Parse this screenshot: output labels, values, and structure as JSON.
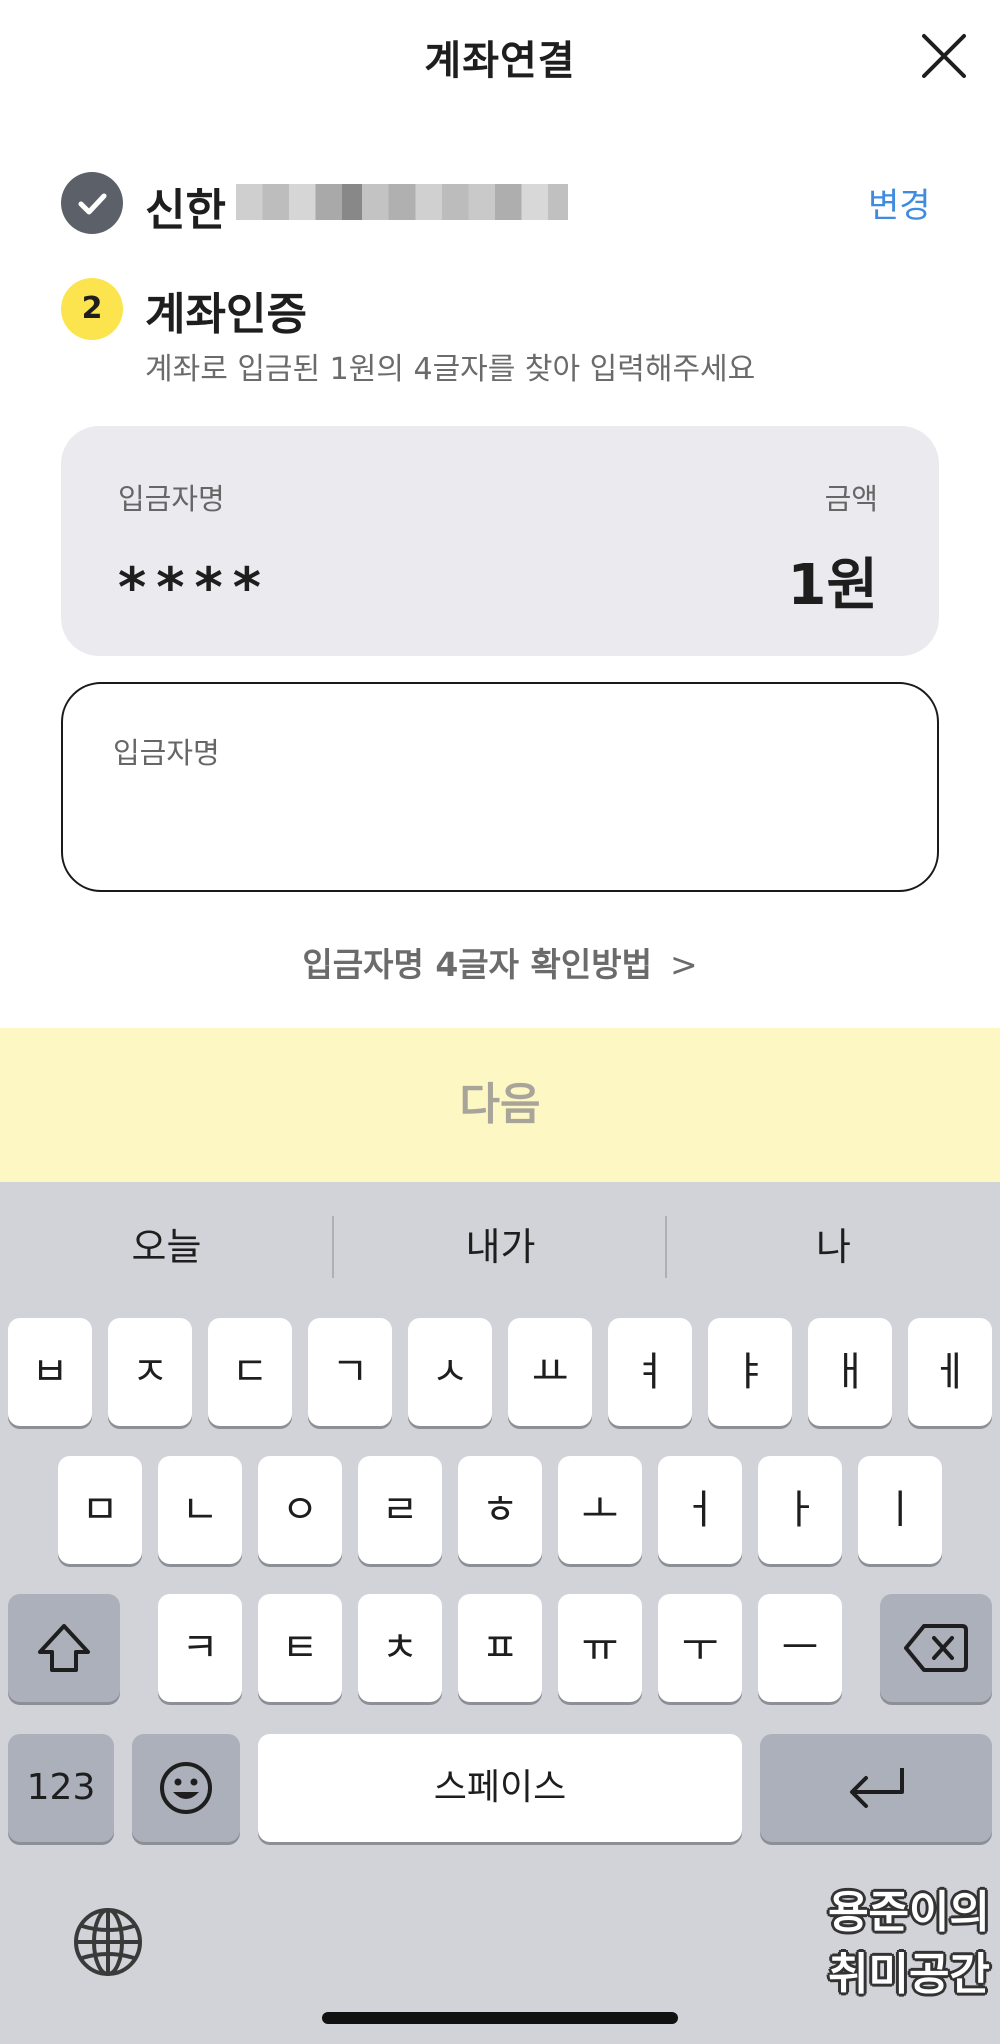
{
  "header": {
    "title": "계좌연결"
  },
  "step1": {
    "bank_name": "신한",
    "change_label": "변경"
  },
  "step2": {
    "number": "2",
    "title": "계좌인증",
    "description": "계좌로 입금된 1원의 4글자를 찾아 입력해주세요"
  },
  "info_box": {
    "depositor_label": "입금자명",
    "depositor_value": "****",
    "amount_label": "금액",
    "amount_value": "1원"
  },
  "input": {
    "label": "입금자명",
    "value": ""
  },
  "help_link": {
    "label": "입금자명 4글자 확인방법",
    "chevron": ">"
  },
  "next_button": {
    "label": "다음"
  },
  "keyboard": {
    "suggestions": [
      "오늘",
      "내가",
      "나"
    ],
    "row1": [
      "ㅂ",
      "ㅈ",
      "ㄷ",
      "ㄱ",
      "ㅅ",
      "ㅛ",
      "ㅕ",
      "ㅑ",
      "ㅐ",
      "ㅔ"
    ],
    "row2": [
      "ㅁ",
      "ㄴ",
      "ㅇ",
      "ㄹ",
      "ㅎ",
      "ㅗ",
      "ㅓ",
      "ㅏ",
      "ㅣ"
    ],
    "row3": [
      "ㅋ",
      "ㅌ",
      "ㅊ",
      "ㅍ",
      "ㅠ",
      "ㅜ",
      "ㅡ"
    ],
    "numbers_key": "123",
    "space_key": "스페이스",
    "icons": {
      "shift": "shift-icon",
      "delete": "backspace-icon",
      "emoji": "emoji-icon",
      "return": "return-icon",
      "globe": "globe-icon"
    }
  },
  "watermark": {
    "line1": "용준이의",
    "line2": "취미공간"
  },
  "colors": {
    "accent": "#3f8be0",
    "step_badge": "#fbe44d",
    "next_bg": "#fdf7c3",
    "keyboard_bg": "#d1d3d9"
  }
}
